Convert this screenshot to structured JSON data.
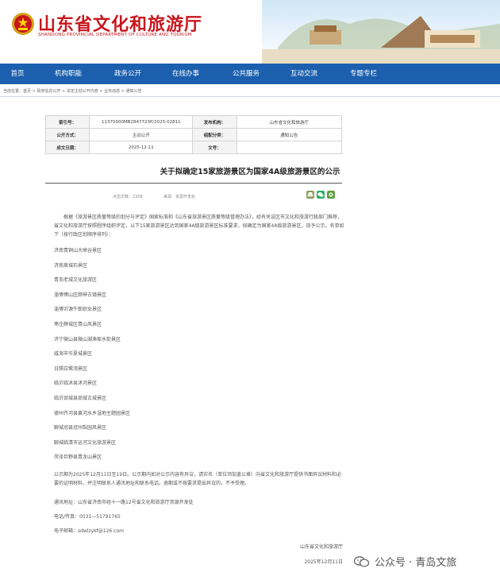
{
  "header": {
    "title": "山东省文化和旅游厅",
    "subtitle": "SHANDONG PROVINCIAL DEPARTMENT OF CULTURE AND TOURISM"
  },
  "nav": [
    "首页",
    "机构职能",
    "政务公开",
    "在线办事",
    "公共服务",
    "互动交流",
    "专题专栏"
  ],
  "breadcrumb": "当前位置：首页 > 政府信息公开 > 法定主动公开内容 > 业务动态 > 通知公告",
  "meta": {
    "index_label": "索引号：",
    "index_value": "11370000MB2847723P/2025-02811",
    "org_label": "发布机构：",
    "org_value": "山东省文化和旅游厅",
    "mode_label": "公开方式：",
    "mode_value": "主动公开",
    "cat_label": "组配分类：",
    "cat_value": "通知公告",
    "date_label": "成文日期：",
    "date_value": "2025-12-11",
    "docno_label": "文号：",
    "docno_value": ""
  },
  "doc": {
    "title": "关于拟确定15家旅游景区为国家4A级旅游景区的公示",
    "views": "点击次数：2309",
    "source": "来源：资源开发处",
    "intro": "根据《旅游景区质量等级的划分与评定》国家标准和《山东省旅游景区质量等级管理办法》，经有关设区市文化和旅游行政部门推荐，省文化和旅游厅按照程序组织评定，以下15家旅游景区达到国家4A级旅游景区标准要求，拟确定为国家4A级旅游景区，现予公示。名单如下（按行政区划顺序排列）：",
    "list": [
      "济南青铜山大峡谷景区",
      "济南泉城石景区",
      "青岛老城文化旅游区",
      "淄博博山区颜神古镇景区",
      "淄博沂源牛郎织女景区",
      "枣庄薛城区青山风景区",
      "济宁微山县微山湖渔家水街景区",
      "威海市华夏城景区",
      "日照白鹭湾景区",
      "临沂临沭县沭河景区",
      "临沂郯城县郯城古城景区",
      "德州齐河县黄河水乡湿地主题园景区",
      "聊城冠县冠州梨园风景区",
      "聊城临清市运河文化旅游景区",
      "菏泽巨野县青龙山景区"
    ],
    "notice": "公示期为2025年12月11日至19日。公示期内如对公示内容有异议，请实名（单位须加盖公章）向省文化和旅游厅提供书面异议材料和必要的证明材料，并注明联系人通讯地址和联系电话。逾期或不按要求提出异议的，不予受理。",
    "address": "通讯地址：山东省济南市经十一路12号省文化和旅游厅资源开发处",
    "phone": "电话/传真：0531—51791765",
    "email": "电子邮箱：sdwlzykf@126.com",
    "sign_org": "山东省文化和旅游厅",
    "sign_date": "2025年12月11日"
  },
  "watermark": "公众号 · 青岛文旅",
  "icons": {
    "emblem": "party-emblem-icon",
    "print": "print-icon",
    "wechat": "wechat-icon",
    "share": "share-icon"
  },
  "colors": {
    "brand_red": "#c8161d",
    "nav_blue": "#1b5fae"
  }
}
